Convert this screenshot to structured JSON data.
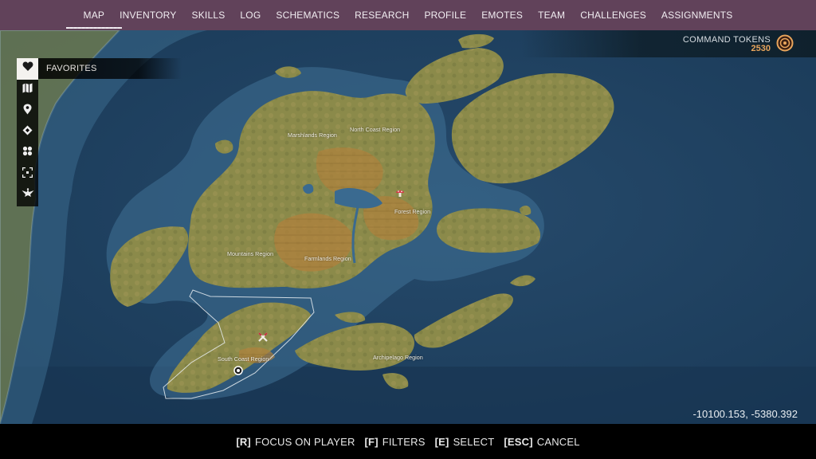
{
  "nav": {
    "items": [
      {
        "label": "MAP",
        "active": true
      },
      {
        "label": "INVENTORY"
      },
      {
        "label": "SKILLS"
      },
      {
        "label": "LOG"
      },
      {
        "label": "SCHEMATICS"
      },
      {
        "label": "RESEARCH"
      },
      {
        "label": "PROFILE"
      },
      {
        "label": "EMOTES"
      },
      {
        "label": "TEAM"
      },
      {
        "label": "CHALLENGES"
      },
      {
        "label": "ASSIGNMENTS"
      }
    ]
  },
  "tokens": {
    "label": "COMMAND TOKENS",
    "value": "2530",
    "icon": "token-medal-icon",
    "color": "#e9a55c"
  },
  "sidebar": {
    "active_label": "FAVORITES",
    "buttons": [
      {
        "icon": "heart-icon"
      },
      {
        "icon": "map-icon"
      },
      {
        "icon": "map-pin-icon"
      },
      {
        "icon": "diamond-marker-icon"
      },
      {
        "icon": "cross-shapes-icon"
      },
      {
        "icon": "focus-frame-icon"
      },
      {
        "icon": "eagle-emblem-icon"
      }
    ]
  },
  "map": {
    "regions": [
      {
        "name": "Marshlands Region"
      },
      {
        "name": "North Coast Region"
      },
      {
        "name": "Forest Region"
      },
      {
        "name": "Mountains Region"
      },
      {
        "name": "Farmlands Region"
      },
      {
        "name": "South Coast Region"
      },
      {
        "name": "Archipelago Region"
      }
    ],
    "markers": [
      {
        "icon": "mushroom-marker-icon"
      },
      {
        "icon": "crossed-tools-marker-icon"
      },
      {
        "icon": "player-location-icon"
      }
    ]
  },
  "coordinates": "-10100.153, -5380.392",
  "hints": [
    {
      "key": "[R]",
      "label": "FOCUS ON PLAYER"
    },
    {
      "key": "[F]",
      "label": "FILTERS"
    },
    {
      "key": "[E]",
      "label": "SELECT"
    },
    {
      "key": "[ESC]",
      "label": "CANCEL"
    }
  ]
}
